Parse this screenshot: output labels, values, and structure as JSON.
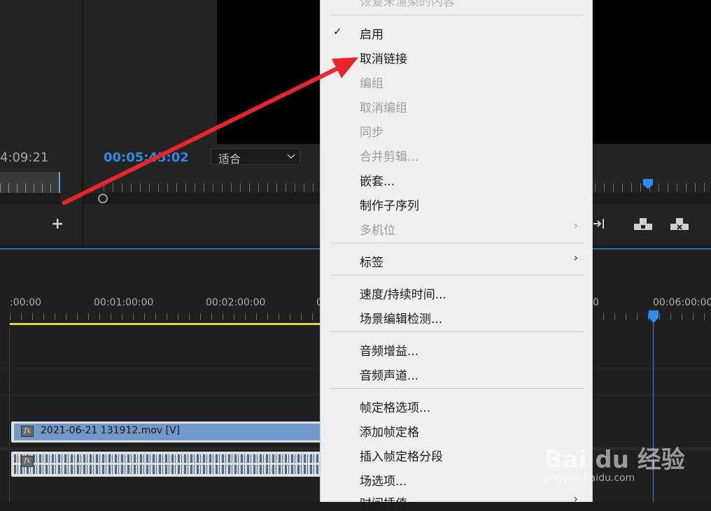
{
  "monitor": {
    "source_timecode": "4:09:21",
    "program_timecode": "00:05:45:02",
    "fit_label": "适合",
    "add_button_glyph": "+"
  },
  "timeline": {
    "ruler_labels": [
      ":00:00",
      "00:01:00:00",
      "00:02:00:00",
      "0",
      "0",
      "00:06:00:00"
    ],
    "video_clip_label": "2021-06-21 131912.mov [V]",
    "fx_badge": "fx",
    "accent_color": "#2d8ceb",
    "work_area_color": "#e6db2a"
  },
  "context_menu": {
    "top_partial": "恢复未渲染的内容",
    "items": [
      {
        "label": "启用",
        "checked": true,
        "enabled": true
      },
      {
        "label": "取消链接",
        "enabled": true
      },
      {
        "label": "编组",
        "enabled": false
      },
      {
        "label": "取消编组",
        "enabled": false
      },
      {
        "label": "同步",
        "enabled": false
      },
      {
        "label": "合并剪辑...",
        "enabled": false
      },
      {
        "label": "嵌套...",
        "enabled": true
      },
      {
        "label": "制作子序列",
        "enabled": true
      },
      {
        "label": "多机位",
        "enabled": false,
        "submenu": true
      },
      {
        "label": "标签",
        "enabled": true,
        "submenu": true
      },
      {
        "label": "速度/持续时间...",
        "enabled": true
      },
      {
        "label": "场景编辑检测...",
        "enabled": true
      },
      {
        "label": "音频增益...",
        "enabled": true
      },
      {
        "label": "音频声道...",
        "enabled": true
      },
      {
        "label": "帧定格选项...",
        "enabled": true
      },
      {
        "label": "添加帧定格",
        "enabled": true
      },
      {
        "label": "插入帧定格分段",
        "enabled": true
      },
      {
        "label": "场选项...",
        "enabled": true
      },
      {
        "label": "时间插值",
        "enabled": true,
        "submenu": true
      }
    ],
    "check_glyph": "✓",
    "submenu_glyph": "›"
  },
  "watermark": {
    "brand": "Bai du 经验",
    "url": "jingyan.baidu.com"
  },
  "annotation": {
    "arrow_color": "#e8262a"
  }
}
